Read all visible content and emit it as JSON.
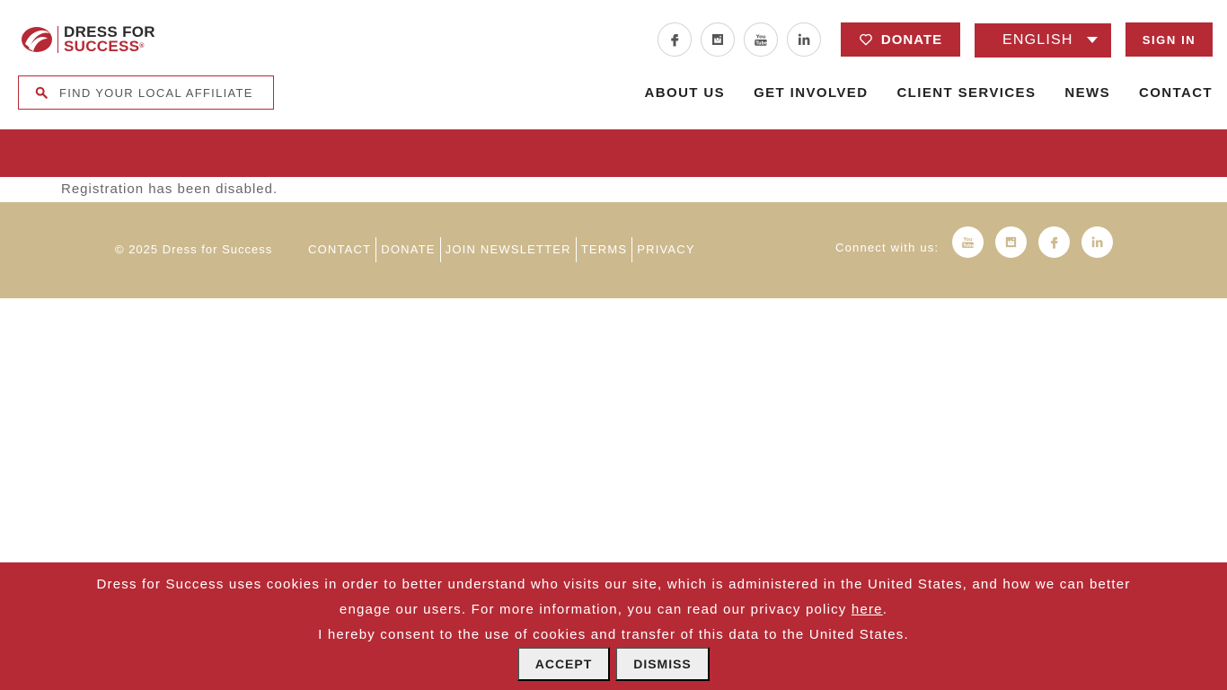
{
  "logo": {
    "line1": "DRESS FOR",
    "line2": "SUCCESS",
    "registered": "®"
  },
  "header": {
    "social_icons": [
      "facebook-icon",
      "instagram-icon",
      "youtube-icon",
      "linkedin-icon"
    ],
    "donate_label": "DONATE",
    "language_selected": "ENGLISH",
    "signin_label": "SIGN IN"
  },
  "search": {
    "placeholder": "FIND YOUR LOCAL AFFILIATE",
    "value": ""
  },
  "nav": {
    "items": [
      {
        "label": "ABOUT US"
      },
      {
        "label": "GET INVOLVED"
      },
      {
        "label": "CLIENT SERVICES"
      },
      {
        "label": "NEWS"
      },
      {
        "label": "CONTACT"
      }
    ]
  },
  "main": {
    "notice": "Registration has been disabled."
  },
  "footer": {
    "copyright": "© 2025 Dress for Success",
    "links": [
      {
        "label": "CONTACT"
      },
      {
        "label": "DONATE"
      },
      {
        "label": "JOIN NEWSLETTER"
      },
      {
        "label": "TERMS"
      },
      {
        "label": "PRIVACY"
      }
    ],
    "connect_label": "Connect with us:",
    "social_icons": [
      "youtube-icon",
      "instagram-icon",
      "facebook-icon",
      "linkedin-icon"
    ]
  },
  "cookie": {
    "text_part1": "Dress for Success uses cookies in order to better understand who visits our site, which is administered in the United States, and how we can better engage our users. For more information, you can read our privacy policy ",
    "link_label": "here",
    "text_part2": ".",
    "consent_text": "I hereby consent to the use of cookies and transfer of this data to the United States.",
    "accept_label": "ACCEPT",
    "dismiss_label": "DISMISS"
  },
  "colors": {
    "brand_red": "#b52a35",
    "footer_tan": "#cdb98e"
  }
}
